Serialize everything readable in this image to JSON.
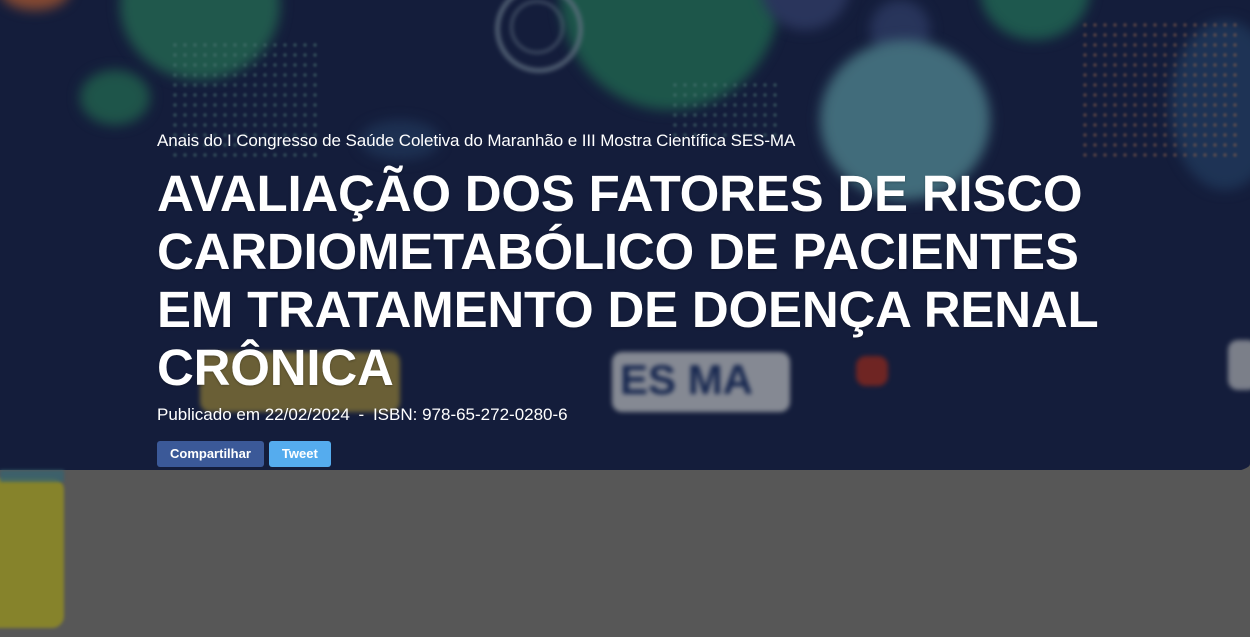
{
  "header": {
    "event_name": "Anais do I Congresso de Saúde Coletiva do Maranhão e III Mostra Científica SES-MA",
    "title": "AVALIAÇÃO DOS FATORES DE RISCO CARDIOMETABÓLICO DE PACIENTES EM TRATAMENTO DE DOENÇA RENAL CRÔNICA",
    "published_label": "Publicado em 22/02/2024",
    "separator": "-",
    "isbn": "ISBN: 978-65-272-0280-6"
  },
  "actions": {
    "share_label": "Compartilhar",
    "tweet_label": "Tweet"
  },
  "colors": {
    "share_button": "#3b5998",
    "tweet_button": "#55acee",
    "banner_background": "#1d2a55"
  }
}
